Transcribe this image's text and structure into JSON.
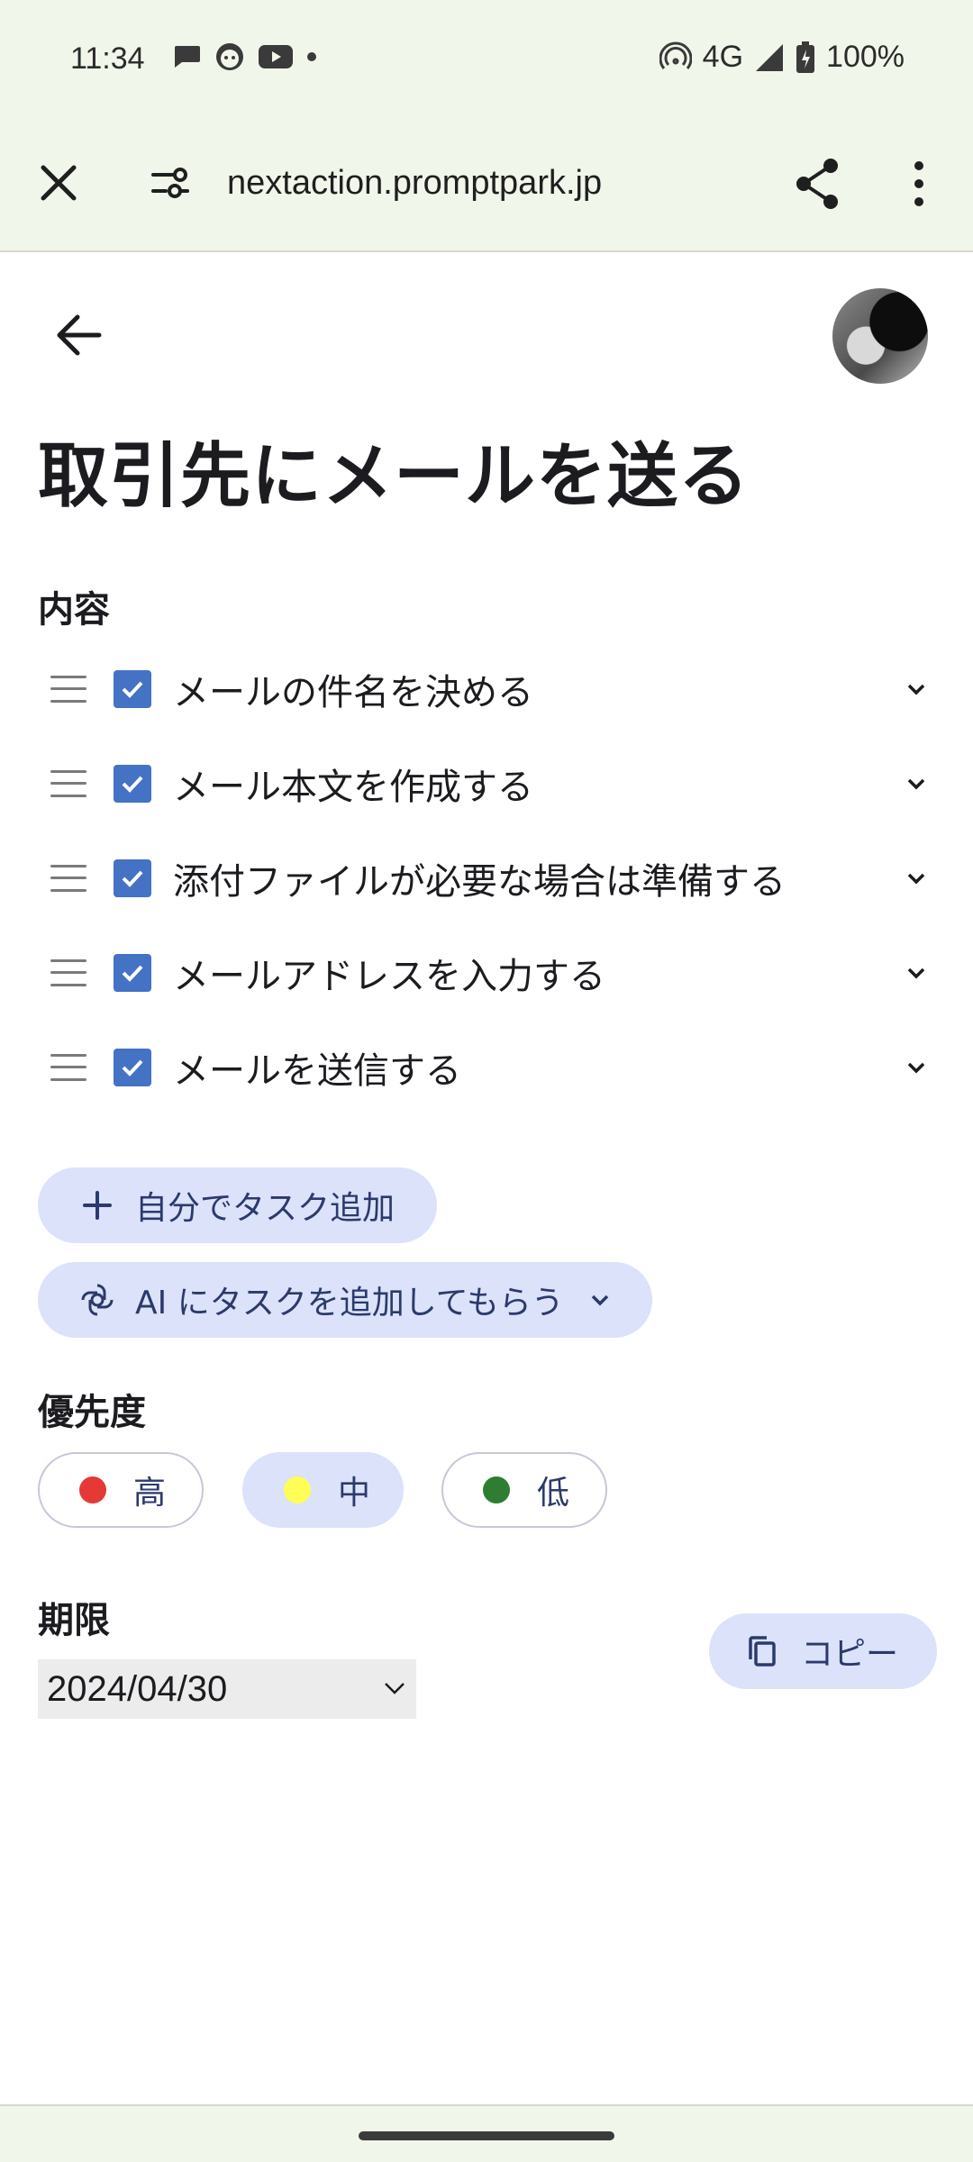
{
  "status_bar": {
    "time": "11:34",
    "network": "4G",
    "battery": "100%",
    "icons": [
      "chat-icon",
      "android-face-icon",
      "youtube-icon",
      "dot-icon",
      "hotspot-icon",
      "signal-icon",
      "battery-icon"
    ]
  },
  "browser": {
    "url": "nextaction.promptpark.jp",
    "icons": [
      "close-icon",
      "site-settings-icon",
      "share-icon",
      "more-vert-icon"
    ]
  },
  "page": {
    "title": "取引先にメールを送る",
    "content_label": "内容",
    "tasks": [
      {
        "label": "メールの件名を決める",
        "checked": true
      },
      {
        "label": "メール本文を作成する",
        "checked": true
      },
      {
        "label": "添付ファイルが必要な場合は準備する",
        "checked": true
      },
      {
        "label": "メールアドレスを入力する",
        "checked": true
      },
      {
        "label": "メールを送信する",
        "checked": true
      }
    ],
    "add_task_label": "自分でタスク追加",
    "ai_task_label": "AI にタスクを追加してもらう",
    "priority_label": "優先度",
    "priorities": [
      {
        "label": "高",
        "color": "#e53935",
        "selected": false
      },
      {
        "label": "中",
        "color": "#ffff55",
        "selected": true
      },
      {
        "label": "低",
        "color": "#2e7d32",
        "selected": false
      }
    ],
    "deadline_label": "期限",
    "deadline_value": "2024/04/30",
    "copy_label": "コピー"
  },
  "colors": {
    "accent_pill": "#dbe2f9",
    "checkbox": "#4472c4",
    "chrome_bg": "#f1f6ea"
  }
}
